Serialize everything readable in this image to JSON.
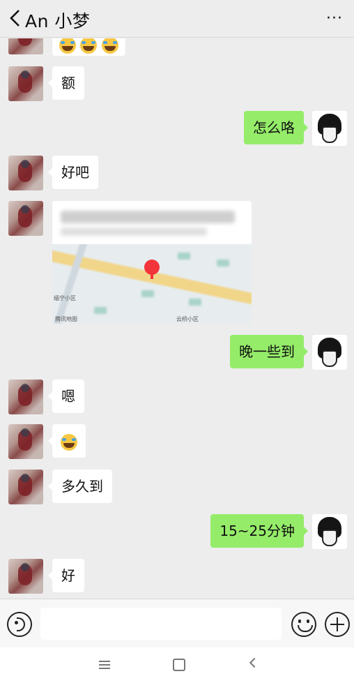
{
  "header": {
    "title": "An 小梦",
    "more_label": "···"
  },
  "messages": [
    {
      "side": "in",
      "text": ""
    },
    {
      "side": "in",
      "text": "额"
    },
    {
      "side": "out",
      "text": "怎么咯"
    },
    {
      "side": "in",
      "text": "好吧"
    },
    {
      "side": "in",
      "type": "location"
    },
    {
      "side": "out",
      "text": "晚一些到"
    },
    {
      "side": "in",
      "text": "嗯"
    },
    {
      "side": "in",
      "type": "emoji",
      "emoji": "crying-laughing"
    },
    {
      "side": "in",
      "text": "多久到"
    },
    {
      "side": "out",
      "text": "15~25分钟"
    },
    {
      "side": "in",
      "text": "好"
    }
  ],
  "map_card": {
    "label_left": "缅宁小区",
    "label_logo": "腾讯地图",
    "label_bottom": "云桥小区"
  },
  "input": {
    "placeholder": ""
  },
  "colors": {
    "outgoing_bubble": "#95ec69",
    "incoming_bubble": "#ffffff",
    "background": "#ededed"
  }
}
